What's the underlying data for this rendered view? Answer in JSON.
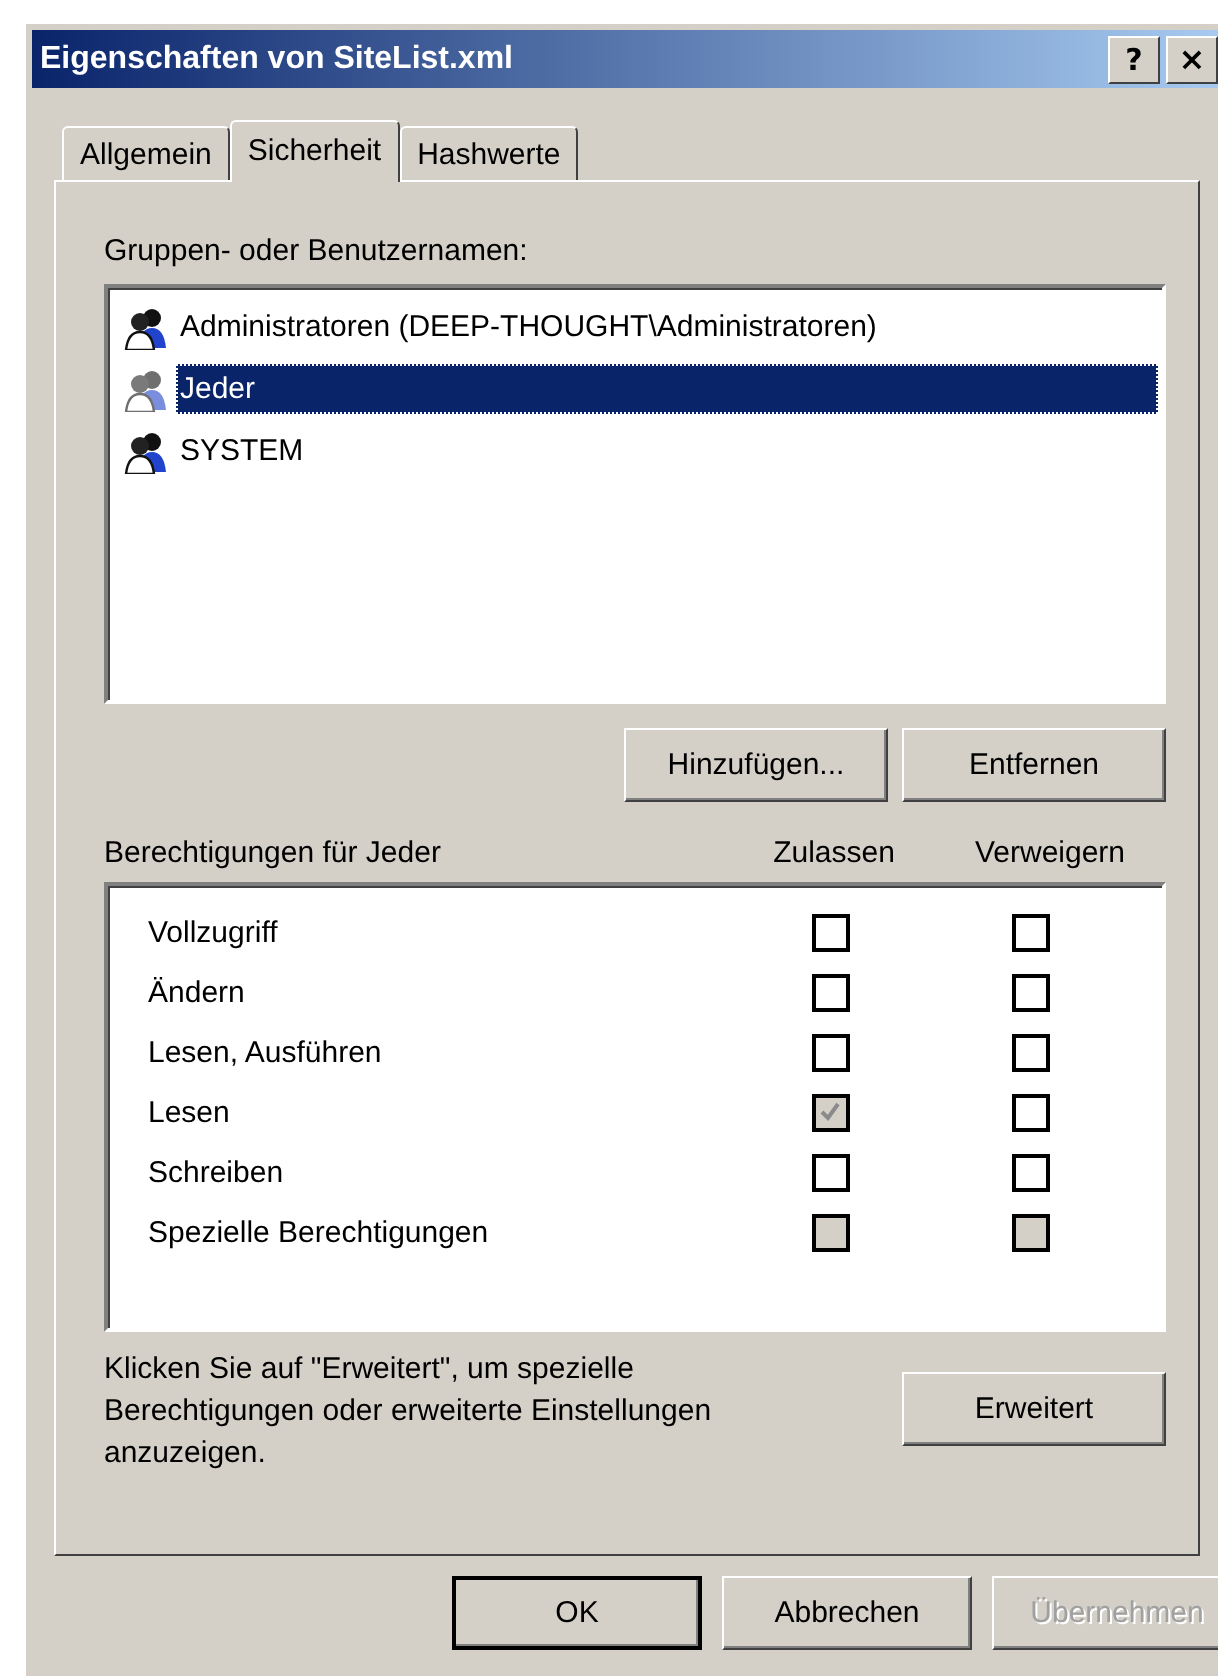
{
  "window": {
    "title": "Eigenschaften von SiteList.xml",
    "caption_buttons": [
      {
        "kind": "help",
        "label": "?"
      },
      {
        "kind": "close",
        "label": "×"
      }
    ]
  },
  "tabs": [
    {
      "label": "Allgemein",
      "selected": false
    },
    {
      "label": "Sicherheit",
      "selected": true
    },
    {
      "label": "Hashwerte",
      "selected": false
    }
  ],
  "principals": {
    "label": "Gruppen- oder Benutzernamen:",
    "items": [
      {
        "name": "Administratoren (DEEP-THOUGHT\\Administratoren)",
        "selected": false
      },
      {
        "name": "Jeder",
        "selected": true
      },
      {
        "name": "SYSTEM",
        "selected": false
      }
    ],
    "buttons": [
      {
        "label": "Hinzufügen...",
        "disabled": false
      },
      {
        "label": "Entfernen",
        "disabled": false
      }
    ]
  },
  "permissions": {
    "label": "Berechtigungen für Jeder",
    "allow_heading": "Zulassen",
    "deny_heading": "Verweigern",
    "rows": [
      {
        "name": "Vollzugriff",
        "allow": {
          "checked": false,
          "disabled": false
        },
        "deny": {
          "checked": false,
          "disabled": false
        }
      },
      {
        "name": "Ändern",
        "allow": {
          "checked": false,
          "disabled": false
        },
        "deny": {
          "checked": false,
          "disabled": false
        }
      },
      {
        "name": "Lesen, Ausführen",
        "allow": {
          "checked": false,
          "disabled": false
        },
        "deny": {
          "checked": false,
          "disabled": false
        }
      },
      {
        "name": "Lesen",
        "allow": {
          "checked": true,
          "disabled": true
        },
        "deny": {
          "checked": false,
          "disabled": false
        }
      },
      {
        "name": "Schreiben",
        "allow": {
          "checked": false,
          "disabled": false
        },
        "deny": {
          "checked": false,
          "disabled": false
        }
      },
      {
        "name": "Spezielle Berechtigungen",
        "allow": {
          "checked": false,
          "disabled": true
        },
        "deny": {
          "checked": false,
          "disabled": true
        }
      }
    ]
  },
  "advanced": {
    "text": "Klicken Sie auf \"Erweitert\", um spezielle Berechtigungen oder erweiterte Einstellungen anzuzeigen.",
    "button": {
      "label": "Erweitert",
      "disabled": false
    }
  },
  "buttons": [
    {
      "label": "OK",
      "kind": "default",
      "disabled": false
    },
    {
      "label": "Abbrechen",
      "kind": "normal",
      "disabled": false
    },
    {
      "label": "Übernehmen",
      "kind": "normal",
      "disabled": true
    }
  ]
}
